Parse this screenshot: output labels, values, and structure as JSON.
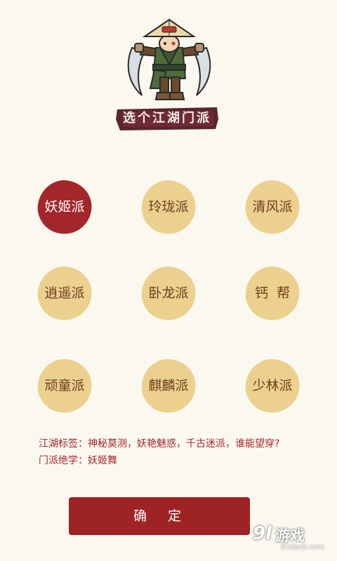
{
  "header": {
    "title": "选个江湖门派"
  },
  "sects": [
    {
      "label": "妖姬派",
      "selected": true
    },
    {
      "label": "玲珑派",
      "selected": false
    },
    {
      "label": "清风派",
      "selected": false
    },
    {
      "label": "逍遥派",
      "selected": false
    },
    {
      "label": "卧龙派",
      "selected": false
    },
    {
      "label": "钙  帮",
      "selected": false
    },
    {
      "label": "顽童派",
      "selected": false
    },
    {
      "label": "麒麟派",
      "selected": false
    },
    {
      "label": "少林派",
      "selected": false
    }
  ],
  "info": {
    "tags": "江湖标签：神秘莫测，妖艳魅惑，千古迷派，谁能望穿?",
    "skill": "门派绝学：妖姬舞"
  },
  "confirm_label": "确  定",
  "watermark": {
    "logo": "9l",
    "brand": "游戏",
    "url": "91danji.com"
  },
  "colors": {
    "background": "#fbf8f0",
    "selected": "#a3272a",
    "unselected": "#ecd08e",
    "label_text": "#6d3d1c",
    "accent": "#9e2325"
  },
  "icons": {
    "mascot": "straw-hat-swordsman-illustration"
  }
}
